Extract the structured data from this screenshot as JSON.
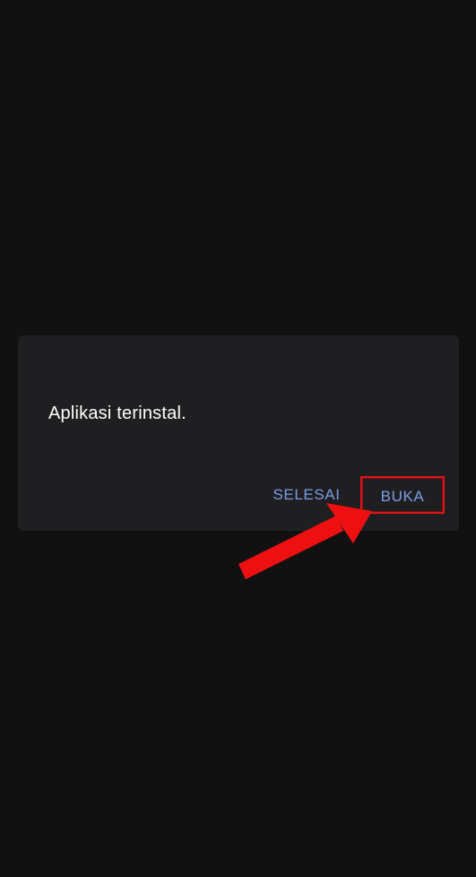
{
  "dialog": {
    "message": "Aplikasi terinstal.",
    "buttons": {
      "done_label": "SELESAI",
      "open_label": "BUKA"
    }
  },
  "colors": {
    "background": "#121112",
    "dialog_background": "#1f1f21",
    "message_text": "#ffffff",
    "button_text": "#7b9de6",
    "highlight": "#e0141b",
    "arrow": "#ee1010"
  },
  "annotation": {
    "highlight_target": "open-button",
    "arrow_icon": "red-arrow-icon"
  }
}
